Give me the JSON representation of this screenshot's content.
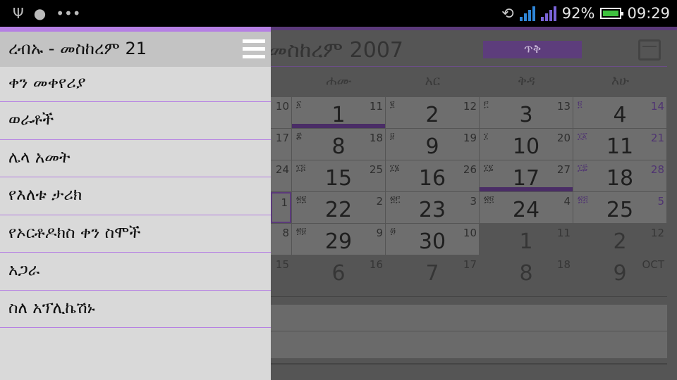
{
  "status_bar": {
    "left_icons": [
      "usb-icon",
      "android-icon",
      "more-icon"
    ],
    "battery_percent": "92%",
    "time": "09:29"
  },
  "calendar": {
    "title": "መስከረም 2007",
    "today_button": "ጥቅ",
    "weekdays": [
      "ሐሙ",
      "አር",
      "ቅዳ",
      "እሁ"
    ],
    "rows": [
      [
        {
          "n": "",
          "g": "10"
        },
        {
          "geez": "፩",
          "n": "1",
          "g": "11",
          "bar": true
        },
        {
          "geez": "፪",
          "n": "2",
          "g": "12"
        },
        {
          "geez": "፫",
          "n": "3",
          "g": "13"
        },
        {
          "geez": "፬",
          "n": "4",
          "g": "14",
          "sun": true
        }
      ],
      [
        {
          "n": "",
          "g": "17"
        },
        {
          "geez": "፰",
          "n": "8",
          "g": "18"
        },
        {
          "geez": "፱",
          "n": "9",
          "g": "19"
        },
        {
          "geez": "፲",
          "n": "10",
          "g": "20"
        },
        {
          "geez": "፲፩",
          "n": "11",
          "g": "21",
          "sun": true
        }
      ],
      [
        {
          "n": "",
          "g": "24"
        },
        {
          "geez": "፲፭",
          "n": "15",
          "g": "25"
        },
        {
          "geez": "፲፮",
          "n": "16",
          "g": "26"
        },
        {
          "geez": "፲፯",
          "n": "17",
          "g": "27",
          "bar": true
        },
        {
          "geez": "፲፰",
          "n": "18",
          "g": "28",
          "sun": true
        }
      ],
      [
        {
          "n": "",
          "g": "1",
          "mark": true
        },
        {
          "geez": "፳፪",
          "n": "22",
          "g": "2"
        },
        {
          "geez": "፳፫",
          "n": "23",
          "g": "3"
        },
        {
          "geez": "፳፬",
          "n": "24",
          "g": "4"
        },
        {
          "geez": "፳፭",
          "n": "25",
          "g": "5",
          "sun": true
        }
      ],
      [
        {
          "n": "",
          "g": "8"
        },
        {
          "geez": "፳፱",
          "n": "29",
          "g": "9"
        },
        {
          "geez": "፴",
          "n": "30",
          "g": "10"
        },
        {
          "geez": "",
          "n": "1",
          "g": "11",
          "dim": true
        },
        {
          "geez": "",
          "n": "2",
          "g": "12",
          "dim": true,
          "sun": true
        }
      ],
      [
        {
          "n": "",
          "g": "15",
          "dim": true
        },
        {
          "geez": "",
          "n": "6",
          "g": "16",
          "dim": true
        },
        {
          "geez": "",
          "n": "7",
          "g": "17",
          "dim": true
        },
        {
          "geez": "",
          "n": "8",
          "g": "18",
          "dim": true
        },
        {
          "geez": "",
          "n": "9",
          "g": "OCT",
          "dim": true,
          "sun": true
        }
      ]
    ]
  },
  "drawer": {
    "header_date": "ረብኡ - መስከረም 21",
    "menu": [
      "ቀን መቀየሪያ",
      "ወራቶች",
      "ሌላ አመት",
      "የእለቱ ታሪክ",
      "የኦርቶዶክስ ቀን ስሞች",
      "አጋራ",
      "ስለ አፕሊኬሽኑ"
    ]
  },
  "colors": {
    "accent": "#b57fe3",
    "accent_dark": "#5b3a7a"
  }
}
